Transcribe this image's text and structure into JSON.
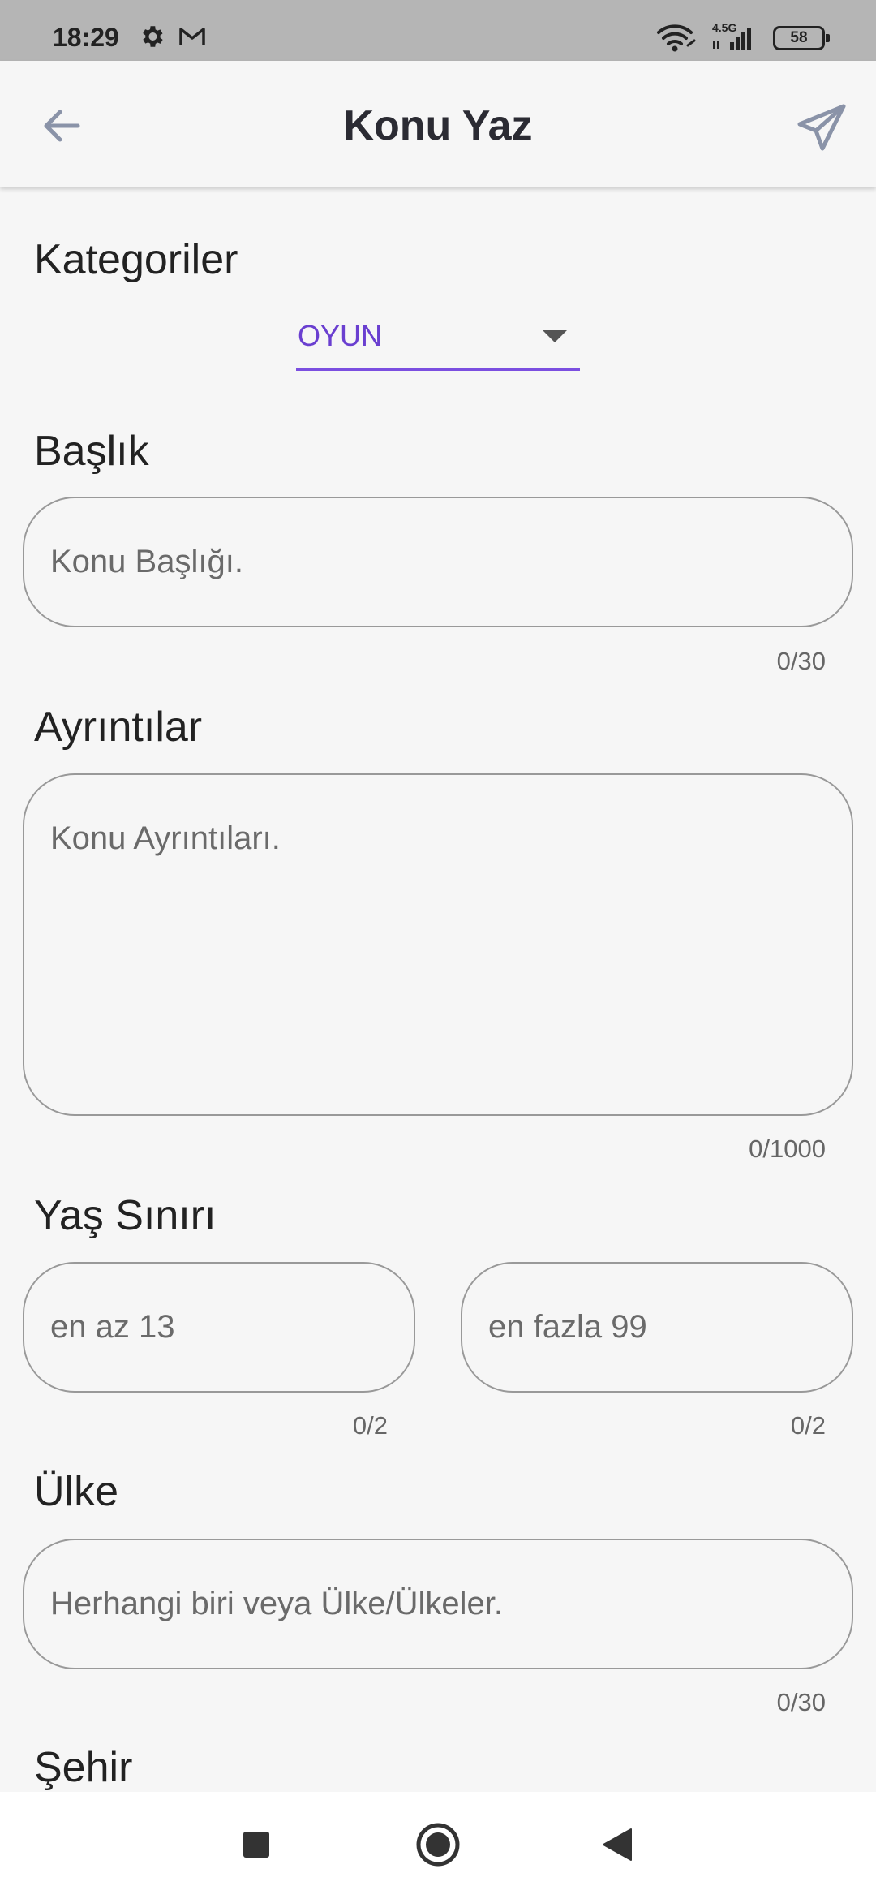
{
  "status_bar": {
    "time": "18:29",
    "network_label": "4.5G",
    "battery": "58",
    "icons": [
      "gear-icon",
      "mail-icon",
      "wifi-icon",
      "signal-icon",
      "battery-icon"
    ]
  },
  "app_bar": {
    "title": "Konu Yaz",
    "back_icon": "arrow-left-icon",
    "send_icon": "paper-plane-icon"
  },
  "form": {
    "categories": {
      "label": "Kategoriler",
      "selected": "OYUN"
    },
    "title_field": {
      "label": "Başlık",
      "placeholder": "Konu Başlığı.",
      "counter": "0/30"
    },
    "details_field": {
      "label": "Ayrıntılar",
      "placeholder": "Konu Ayrıntıları.",
      "counter": "0/1000"
    },
    "age_limit": {
      "label": "Yaş Sınırı",
      "min_placeholder": "en az 13",
      "min_counter": "0/2",
      "max_placeholder": "en fazla 99",
      "max_counter": "0/2"
    },
    "country_field": {
      "label": "Ülke",
      "placeholder": "Herhangi biri veya Ülke/Ülkeler.",
      "counter": "0/30"
    },
    "city_field": {
      "label": "Şehir"
    }
  },
  "nav_bar": {
    "icons": [
      "square-icon",
      "circle-icon",
      "triangle-back-icon"
    ]
  },
  "colors": {
    "accent": "#7b4fe0",
    "accent_text": "#6a3fd0",
    "background": "#f6f6f6",
    "status_bar": "#b5b5b5",
    "icon_gray": "#8a93a8"
  }
}
